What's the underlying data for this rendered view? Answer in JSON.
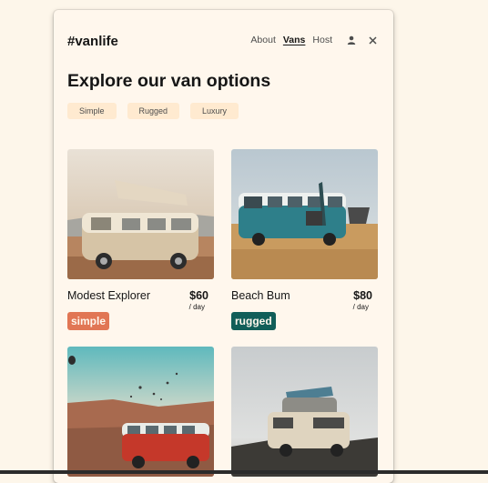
{
  "header": {
    "logo": "#vanlife",
    "nav": [
      {
        "label": "About",
        "active": false
      },
      {
        "label": "Vans",
        "active": true
      },
      {
        "label": "Host",
        "active": false
      }
    ],
    "icons": [
      "person-icon",
      "close-icon"
    ]
  },
  "page": {
    "title": "Explore our van options",
    "filters": [
      "Simple",
      "Rugged",
      "Luxury"
    ]
  },
  "vans": [
    {
      "name": "Modest Explorer",
      "price": "$60",
      "per": "/ day",
      "type": "simple",
      "image": "beige vw camper van with pop-top roof in desert"
    },
    {
      "name": "Beach Bum",
      "price": "$80",
      "per": "/ day",
      "type": "rugged",
      "image": "teal and white vw camper van with umbrella"
    },
    {
      "name": "",
      "price": "",
      "per": "",
      "type": "",
      "image": "red and white vw van under hot air balloons"
    },
    {
      "name": "",
      "price": "",
      "per": "",
      "type": "",
      "image": "grey camper van with surfboard on roof"
    }
  ],
  "colors": {
    "background": "#fff7ed",
    "chip": "#ffead0",
    "simple": "#e17654",
    "rugged": "#115e59",
    "text": "#161616"
  }
}
